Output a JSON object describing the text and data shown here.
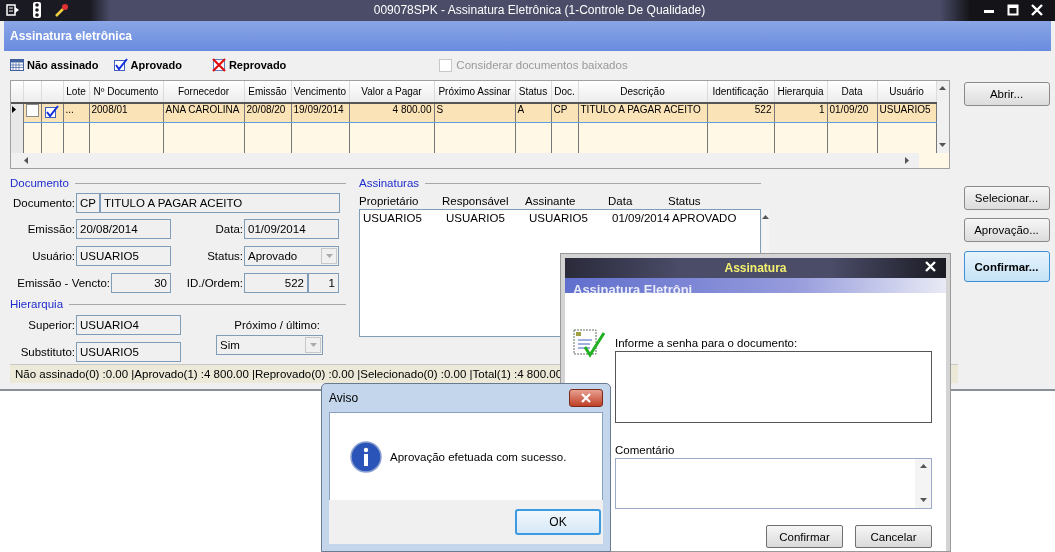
{
  "window": {
    "title": "009078SPK - Assinatura Eletrônica (1-Controle De Qualidade)"
  },
  "header": {
    "title": "Assinatura eletrônica"
  },
  "legend": [
    {
      "kind": "pending",
      "label": "Não assinado"
    },
    {
      "kind": "approved",
      "label": "Aprovado"
    },
    {
      "kind": "rejected",
      "label": "Reprovado"
    }
  ],
  "show_closed": {
    "label": "Considerar documentos baixados",
    "checked": false,
    "disabled": true
  },
  "table": {
    "columns": [
      "Lote",
      "Nº Documento",
      "Fornecedor",
      "Emissão",
      "Vencimento",
      "Valor a Pagar",
      "Próximo Assinar",
      "Status",
      "Doc.",
      "Descrição",
      "Identificação",
      "Hierarquia",
      "Data",
      "Usuário"
    ],
    "rows": [
      {
        "selected": true,
        "checked": false,
        "kind": "approved",
        "cells": [
          "...",
          "2008/01",
          "ANA CAROLINA",
          "20/08/20",
          "19/09/2014",
          "4 800.00",
          "S",
          "A",
          "CP",
          "TITULO A PAGAR ACEITO",
          "522",
          "1",
          "01/09/20",
          "USUARIO5"
        ]
      }
    ]
  },
  "open_button": {
    "label": "Abrir..."
  },
  "action_buttons": [
    {
      "label": "Selecionar...",
      "default": false
    },
    {
      "label": "Aprovação...",
      "default": false
    },
    {
      "label": "Confirmar...",
      "default": true
    }
  ],
  "document": {
    "title": "Documento",
    "doc_label": "Documento:",
    "doc_type": "CP",
    "doc_desc": "TITULO A PAGAR ACEITO",
    "issue_label": "Emissão:",
    "issue": "20/08/2014",
    "date_label": "Data:",
    "date": "01/09/2014",
    "user_label": "Usuário:",
    "user": "USUARIO5",
    "status_label": "Status:",
    "status": "Aprovado",
    "days_label": "Emissão - Vencto:",
    "days": "30",
    "id_label": "ID./Ordem:",
    "id": "522",
    "order": "1"
  },
  "hierarchy": {
    "title": "Hierarquia",
    "superior_label": "Superior:",
    "superior": "USUARIO4",
    "substitute_label": "Substituto:",
    "substitute": "USUARIO5",
    "next_label": "Próximo / último:",
    "next": "Sim"
  },
  "signatures": {
    "title": "Assinaturas",
    "columns": [
      "Proprietário",
      "Responsável",
      "Assinante",
      "Data",
      "Status"
    ],
    "rows": [
      [
        "USUARIO5",
        "USUARIO5",
        "USUARIO5",
        "01/09/2014",
        "APROVADO"
      ]
    ]
  },
  "status_bar": "Não assinado(0) :0.00 |Aprovado(1) :4 800.00 |Reprovado(0) :0.00 |Selecionado(0) :0.00 |Total(1) :4 800.00",
  "sign_dialog": {
    "title": "Assinatura",
    "banner": "Assinatura Eletrôni",
    "password_label": "Informe a senha para o documento:",
    "comment_label": "Comentário",
    "buttons": [
      "Confirmar",
      "Cancelar"
    ]
  },
  "alert": {
    "title": "Aviso",
    "message": "Aprovação efetuada com sucesso.",
    "button": "OK"
  }
}
